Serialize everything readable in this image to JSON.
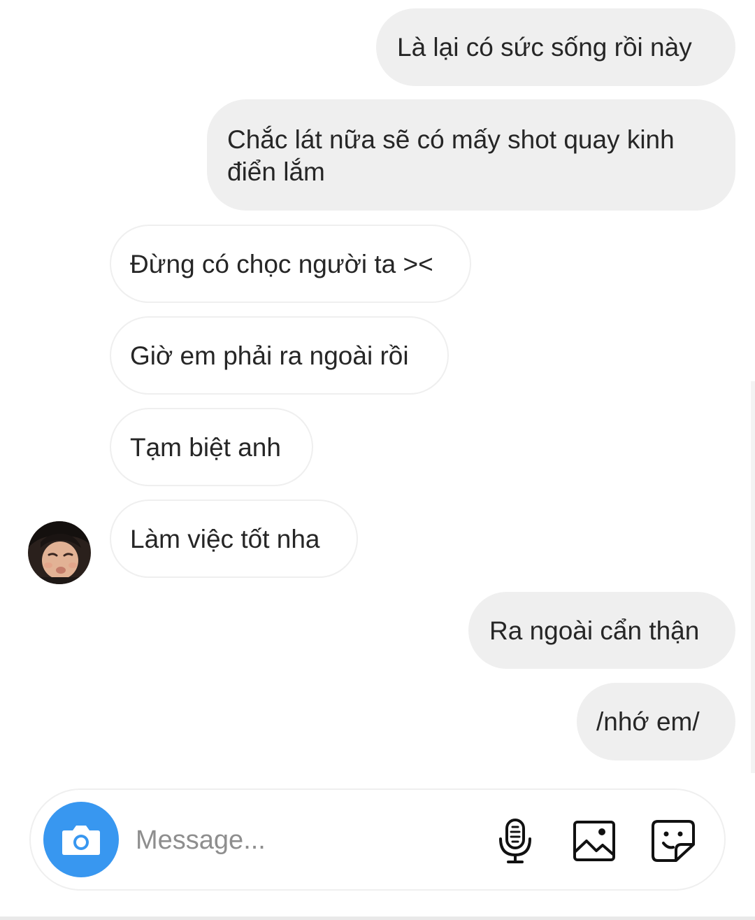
{
  "messages": [
    {
      "direction": "sent",
      "text": "Là lại có sức sống rồi này"
    },
    {
      "direction": "sent",
      "text": "Chắc lát nữa sẽ có mấy shot quay kinh điển lắm"
    },
    {
      "direction": "received",
      "text": "Đừng có chọc người ta ><"
    },
    {
      "direction": "received",
      "text": "Giờ em phải ra ngoài rồi"
    },
    {
      "direction": "received",
      "text": "Tạm biệt anh"
    },
    {
      "direction": "received",
      "text": "Làm việc tốt nha"
    },
    {
      "direction": "sent",
      "text": "Ra ngoài cẩn thận"
    },
    {
      "direction": "sent",
      "text": "/nhớ em/"
    }
  ],
  "composer": {
    "placeholder": "Message...",
    "value": ""
  },
  "icons": {
    "camera": "camera-icon",
    "microphone": "microphone-icon",
    "gallery": "image-icon",
    "sticker": "sticker-icon"
  },
  "colors": {
    "sent_bubble": "#efefef",
    "received_border": "#efefef",
    "text": "#262626",
    "accent": "#3897f0",
    "placeholder": "#8e8e8e"
  }
}
